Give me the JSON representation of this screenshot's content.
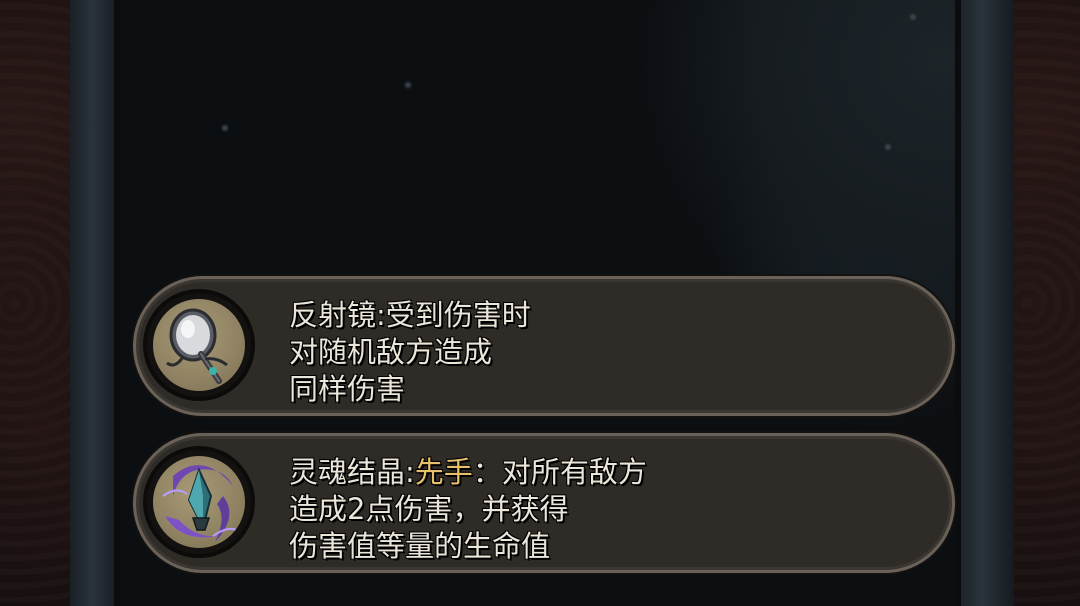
{
  "relics": [
    {
      "icon": "mirror-icon",
      "name": "反射镜",
      "separator": ":",
      "line1_rest": "受到伤害时",
      "line2": "对随机敌方造成",
      "line3": "同样伤害"
    },
    {
      "icon": "soul-crystal-icon",
      "name": "灵魂结晶",
      "separator": ":",
      "keyword": "先手",
      "line1_rest": "：对所有敌方",
      "line2": "造成2点伤害，并获得",
      "line3": "伤害值等量的生命值"
    }
  ],
  "colors": {
    "text": "#ece6da",
    "keyword": "#e9c06a",
    "card_bg": "#2f2c28",
    "card_border": "#6a6258"
  }
}
